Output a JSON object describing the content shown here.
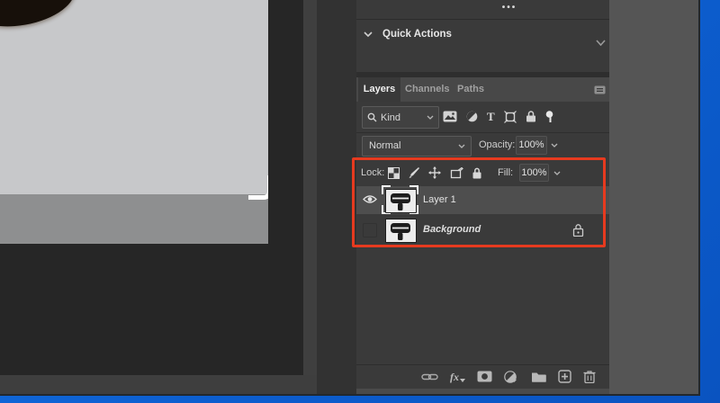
{
  "properties_panel": {
    "menu_dots": "•••",
    "quick_actions": {
      "label": "Quick Actions"
    }
  },
  "layers_panel": {
    "tabs": [
      {
        "label": "Layers",
        "active": true
      },
      {
        "label": "Channels",
        "active": false
      },
      {
        "label": "Paths",
        "active": false
      }
    ],
    "filter": {
      "kind": {
        "label": "Kind"
      },
      "type_glyph": "T",
      "icon_names": [
        "pixel-layers-filter",
        "adjustment-layers-filter",
        "type-layers-filter",
        "shape-layers-filter",
        "smart-object-filter",
        "filter-pin-toggle"
      ]
    },
    "blend_mode": {
      "value": "Normal"
    },
    "opacity": {
      "label": "Opacity:",
      "value": "100%"
    },
    "lock": {
      "label": "Lock:"
    },
    "fill": {
      "label": "Fill:",
      "value": "100%"
    },
    "layers": [
      {
        "name": "Layer 1",
        "selected": true,
        "visible": true,
        "locked": false
      },
      {
        "name": "Background",
        "selected": false,
        "visible": false,
        "locked": true,
        "italic": true
      }
    ],
    "bottom_bar": {
      "fx_label": "fx"
    }
  },
  "highlight": {
    "color": "#e63a1f",
    "purpose": "tutorial-callout around lock row and layer list"
  },
  "colors": {
    "panel_bg": "#3a3a3a",
    "selected_row": "#4e4e4e",
    "canvas_bg": "#262626",
    "desktop_blue": "#0c5ecf"
  }
}
